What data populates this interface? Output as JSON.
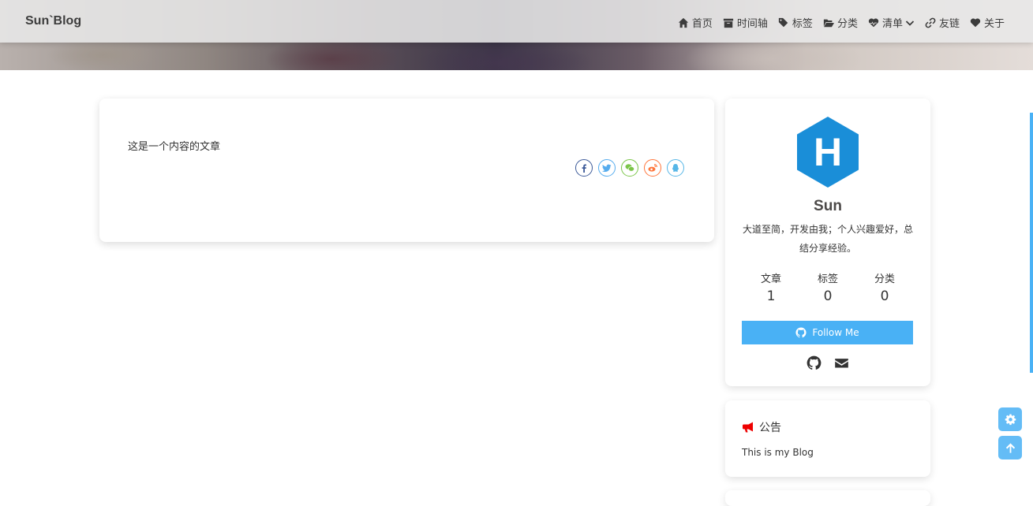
{
  "site": {
    "name": "Sun`Blog"
  },
  "nav": {
    "items": [
      {
        "label": "首页",
        "icon": "home-icon"
      },
      {
        "label": "时间轴",
        "icon": "archive-icon"
      },
      {
        "label": "标签",
        "icon": "tags-icon"
      },
      {
        "label": "分类",
        "icon": "folder-open-icon"
      },
      {
        "label": "清单",
        "icon": "heartbeat-icon"
      },
      {
        "label": "友链",
        "icon": "link-icon"
      },
      {
        "label": "关于",
        "icon": "heart-icon"
      }
    ]
  },
  "post": {
    "content": "这是一个内容的文章",
    "share": [
      {
        "name": "facebook-share-icon",
        "color": "#3b5998"
      },
      {
        "name": "twitter-share-icon",
        "color": "#55acee"
      },
      {
        "name": "wechat-share-icon",
        "color": "#7bc549"
      },
      {
        "name": "weibo-share-icon",
        "color": "#ff763b"
      },
      {
        "name": "qq-share-icon",
        "color": "#56b6e7"
      }
    ]
  },
  "author": {
    "avatar_letter": "H",
    "name": "Sun",
    "description": "大道至简，开发由我；个人兴趣爱好，总结分享经验。",
    "stats": [
      {
        "label": "文章",
        "value": "1"
      },
      {
        "label": "标签",
        "value": "0"
      },
      {
        "label": "分类",
        "value": "0"
      }
    ],
    "follow_label": "Follow Me",
    "accent": "#49b1f5"
  },
  "announcement": {
    "title": "公告",
    "text": "This is my Blog"
  }
}
